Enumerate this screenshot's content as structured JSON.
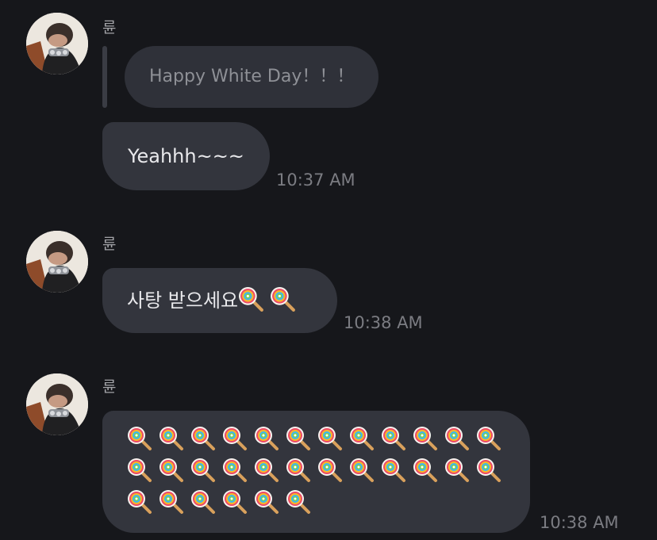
{
  "messages": [
    {
      "sender": "륜",
      "reply_quote": "Happy White Day！！！",
      "text": "Yeahhh~~~",
      "time": "10:37 AM"
    },
    {
      "sender": "륜",
      "text": "사탕 받으세요",
      "emoji_after_text": [
        "lollipop",
        "lollipop"
      ],
      "time": "10:38 AM"
    },
    {
      "sender": "륜",
      "emoji_count": 30,
      "emoji": "lollipop",
      "time": "10:38 AM"
    }
  ],
  "theme": {
    "background": "#16171b",
    "bubble": "#33353d",
    "reply_bubble": "#2f3139",
    "text": "#e9e9ec",
    "meta_text": "#7b7c82"
  }
}
